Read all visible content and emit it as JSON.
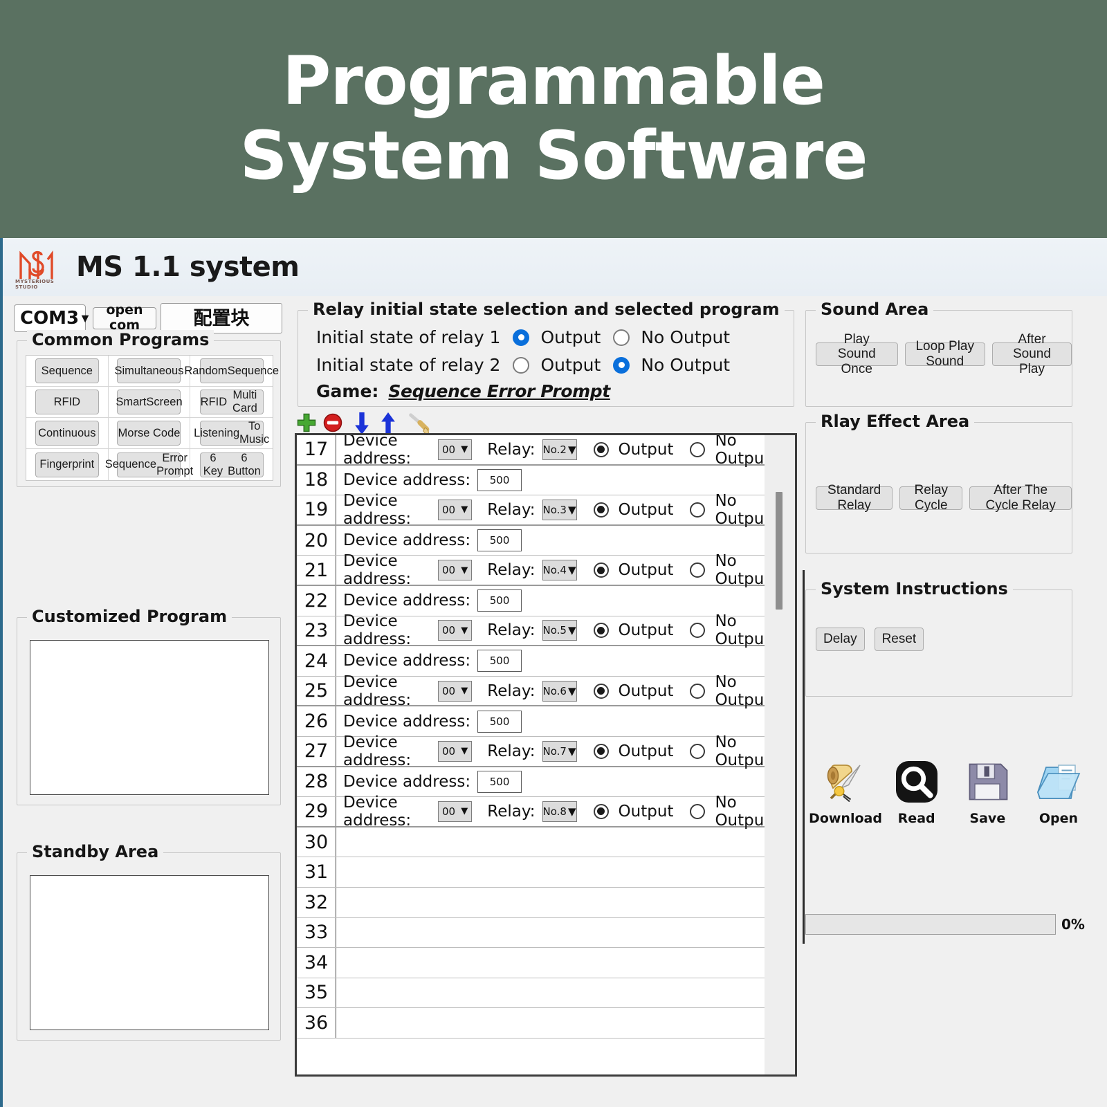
{
  "banner": {
    "line1": "Programmable",
    "line2": "System Software",
    "bg_color": "#5a7161"
  },
  "titlebar": {
    "app_title": "MS 1.1 system",
    "logo_text": "MYSTERIOUS STUDIO",
    "logo_color": "#e04a28"
  },
  "topbar": {
    "com_port": "COM3",
    "com_caret": "▼",
    "open_com_label": "open com",
    "config_label": "配置块"
  },
  "common_programs": {
    "legend": "Common Programs",
    "buttons": [
      "Sequence",
      "Simultaneous",
      "Random\nSequence",
      "RFID",
      "Smart\nScreen",
      "RFID\nMulti Card",
      "Continuous",
      "Morse Code",
      "Listening\nTo Music",
      "Fingerprint",
      "Sequence\nError Prompt",
      "6 Key\n6 Button"
    ]
  },
  "customized_program": {
    "legend": "Customized Program",
    "content": ""
  },
  "standby_area": {
    "legend": "Standby Area",
    "content": ""
  },
  "relay_panel": {
    "legend": "Relay initial state selection and selected program",
    "relay1": {
      "label": "Initial state of relay 1",
      "output_label": "Output",
      "no_output_label": "No Output",
      "selected": "Output"
    },
    "relay2": {
      "label": "Initial state of relay 2",
      "output_label": "Output",
      "no_output_label": "No Output",
      "selected": "No Output"
    },
    "game_label": "Game:",
    "game_value": "Sequence Error Prompt"
  },
  "toolbar": {
    "icons": [
      "add-icon",
      "remove-icon",
      "move-down-icon",
      "move-up-icon",
      "clear-icon"
    ]
  },
  "table": {
    "device_address_label": "Device address:",
    "relay_label": "Relay:",
    "output_label": "Output",
    "no_output_label": "No Output",
    "address_value": "00",
    "delay_value": "500",
    "rows": [
      {
        "num": "17",
        "type": "relay",
        "address": "00",
        "relay": "No.2",
        "selected": "Output"
      },
      {
        "num": "18",
        "type": "delay",
        "value": "500"
      },
      {
        "num": "19",
        "type": "relay",
        "address": "00",
        "relay": "No.3",
        "selected": "Output"
      },
      {
        "num": "20",
        "type": "delay",
        "value": "500"
      },
      {
        "num": "21",
        "type": "relay",
        "address": "00",
        "relay": "No.4",
        "selected": "Output"
      },
      {
        "num": "22",
        "type": "delay",
        "value": "500"
      },
      {
        "num": "23",
        "type": "relay",
        "address": "00",
        "relay": "No.5",
        "selected": "Output"
      },
      {
        "num": "24",
        "type": "delay",
        "value": "500"
      },
      {
        "num": "25",
        "type": "relay",
        "address": "00",
        "relay": "No.6",
        "selected": "Output"
      },
      {
        "num": "26",
        "type": "delay",
        "value": "500"
      },
      {
        "num": "27",
        "type": "relay",
        "address": "00",
        "relay": "No.7",
        "selected": "Output"
      },
      {
        "num": "28",
        "type": "delay",
        "value": "500"
      },
      {
        "num": "29",
        "type": "relay",
        "address": "00",
        "relay": "No.8",
        "selected": "Output"
      },
      {
        "num": "30",
        "type": "empty"
      },
      {
        "num": "31",
        "type": "empty"
      },
      {
        "num": "32",
        "type": "empty"
      },
      {
        "num": "33",
        "type": "empty"
      },
      {
        "num": "34",
        "type": "empty"
      },
      {
        "num": "35",
        "type": "empty"
      },
      {
        "num": "36",
        "type": "empty"
      }
    ]
  },
  "sound_area": {
    "legend": "Sound Area",
    "buttons": [
      "Play Sound Once",
      "Loop Play Sound",
      "After Sound Play"
    ]
  },
  "rlay_effect_area": {
    "legend": "Rlay Effect Area",
    "buttons": [
      "Standard Relay",
      "Relay Cycle",
      "After The Cycle Relay"
    ]
  },
  "system_instructions": {
    "legend": "System Instructions",
    "buttons": [
      "Delay",
      "Reset"
    ]
  },
  "actions": [
    {
      "label": "Download",
      "icon": "scroll-quill-icon"
    },
    {
      "label": "Read",
      "icon": "magnifier-icon"
    },
    {
      "label": "Save",
      "icon": "floppy-disk-icon"
    },
    {
      "label": "Open",
      "icon": "open-folder-icon"
    }
  ],
  "progress": {
    "percent_label": "0%",
    "value": 0
  }
}
